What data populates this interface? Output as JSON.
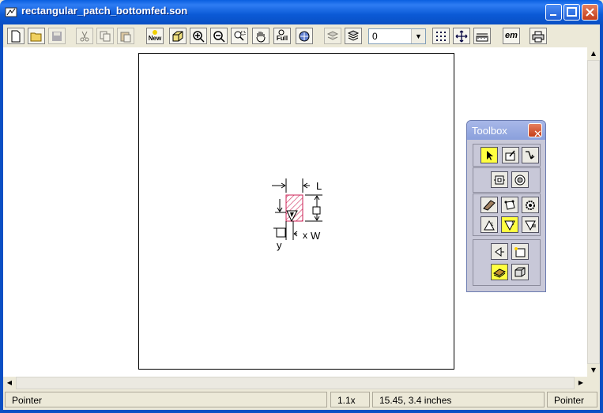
{
  "window": {
    "title": "rectangular_patch_bottomfed.son",
    "title_icon": "sonnet-project-icon",
    "controls": [
      "minimize-icon",
      "maximize-icon",
      "close-icon"
    ]
  },
  "toolbar": {
    "buttons": [
      "new-file-icon",
      "open-folder-icon",
      "save-icon",
      "cut-icon",
      "copy-icon",
      "paste-icon",
      "new-view-icon",
      "3d-view-icon",
      "zoom-in-icon",
      "zoom-out-icon",
      "zoom-rect-icon",
      "pan-hand-icon",
      "zoom-full-icon",
      "center-view-icon",
      "layers-icon",
      "stack-icon",
      "grid-icon",
      "move-icon",
      "ruler-icon",
      "em-icon",
      "print-icon"
    ],
    "new_label": "New",
    "full_label": "Full",
    "em_label": "em",
    "level_value": "0"
  },
  "layout_text": {
    "label_L": "L",
    "label_W": "W",
    "label_x": "x",
    "label_y": "y"
  },
  "toolbox": {
    "title": "Toolbox"
  },
  "status": {
    "mode": "Pointer",
    "zoom": "1.1x",
    "coords": "15.45, 3.4 inches",
    "tool": "Pointer"
  },
  "colors": {
    "titlebar": "#0a5fe0",
    "patch_hatch": "#cc2255",
    "selected_tool": "#ffff40"
  }
}
